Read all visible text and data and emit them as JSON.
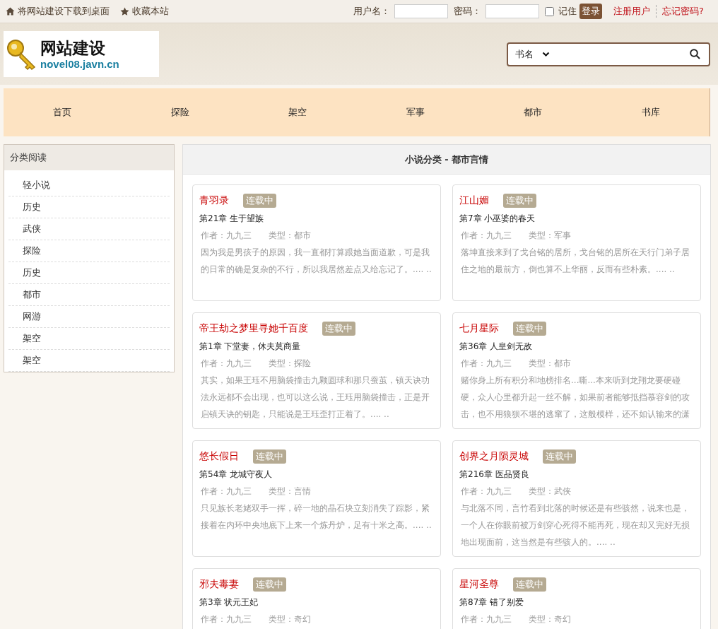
{
  "topbar": {
    "links": [
      {
        "kind": "home",
        "text": "将网站建设下载到桌面"
      },
      {
        "kind": "star",
        "text": "收藏本站"
      }
    ],
    "login": {
      "username_label": "用户名：",
      "password_label": "密码：",
      "remember": {
        "label": "记住",
        "checked": false
      },
      "button": "登录",
      "register": "注册用户",
      "forgot": "忘记密码?"
    }
  },
  "logo": {
    "title": "网站建设",
    "subtitle": "novel08.javn.cn"
  },
  "search": {
    "category": "书名"
  },
  "nav": [
    "首页",
    "探险",
    "架空",
    "军事",
    "都市",
    "书库"
  ],
  "sidebar": {
    "title": "分类阅读",
    "items": [
      "轻小说",
      "历史",
      "武侠",
      "探险",
      "历史",
      "都市",
      "网游",
      "架空",
      "架空"
    ]
  },
  "main": {
    "title": "小说分类 - 都市言情",
    "books": [
      {
        "title": "青羽录",
        "status": "连载中",
        "chapter": "第21章 生于望族",
        "author": "作者：九九三",
        "type": "类型：都市",
        "summary": "因为我是男孩子的原因，我一直都打算跟她当面道歉，可是我的日常的确是复杂的不行，所以我居然差点又给忘记了。.... .."
      },
      {
        "title": "江山媚",
        "status": "连载中",
        "chapter": "第7章 小巫婆的春天",
        "author": "作者：九九三",
        "type": "类型：军事",
        "summary": "落坤直接来到了戈台铭的居所，戈台铭的居所在天行门弟子居住之地的最前方，倒也算不上华丽，反而有些朴素。.... .."
      },
      {
        "title": "帝王劫之梦里寻她千百度",
        "status": "连载中",
        "chapter": "第1章 下堂妻，休夫莫商量",
        "author": "作者：九九三",
        "type": "类型：探险",
        "summary": "其实，如果王珏不用脑袋撞击九颗圆球和那只蚕茧，镇天诀功法永远都不会出现，也可以这么说，王珏用脑袋撞击，正是开启镇天诀的钥匙，只能说是王珏歪打正着了。.... .."
      },
      {
        "title": "七月星际",
        "status": "连载中",
        "chapter": "第36章 人皇剑无敌",
        "author": "作者：九九三",
        "type": "类型：都市",
        "summary": "赌你身上所有积分和地榜排名...嘶...本来听到龙翔龙要硬碰硬，众人心里都升起一丝不解，如果前者能够抵挡慕容剑的攻击，也不用狼狈不堪的逃窜了，这般模样，还不如认输来的潇"
      },
      {
        "title": "悠长假日",
        "status": "连载中",
        "chapter": "第54章 龙城守夜人",
        "author": "作者：九九三",
        "type": "类型：言情",
        "summary": "只见族长老姥双手一挥，碎一地的晶石块立刻消失了踪影，紧接着在内环中央地底下上来一个炼丹炉，足有十米之高。.... .."
      },
      {
        "title": "创界之月陨灵城",
        "status": "连载中",
        "chapter": "第216章 医品贤良",
        "author": "作者：九九三",
        "type": "类型：武侠",
        "summary": "与北落不同，言竹看到北落的时候还是有些骇然，说来也是，一个人在你眼前被万剑穿心死得不能再死，现在却又完好无损地出现面前，这当然是有些骇人的。.... .."
      },
      {
        "title": "邪夫毒妻",
        "status": "连载中",
        "chapter": "第3章 状元王妃",
        "author": "作者：九九三",
        "type": "类型：奇幻"
      },
      {
        "title": "星河圣尊",
        "status": "连载中",
        "chapter": "第87章 错了别爱",
        "author": "作者：九九三",
        "type": "类型：奇幻"
      }
    ]
  }
}
